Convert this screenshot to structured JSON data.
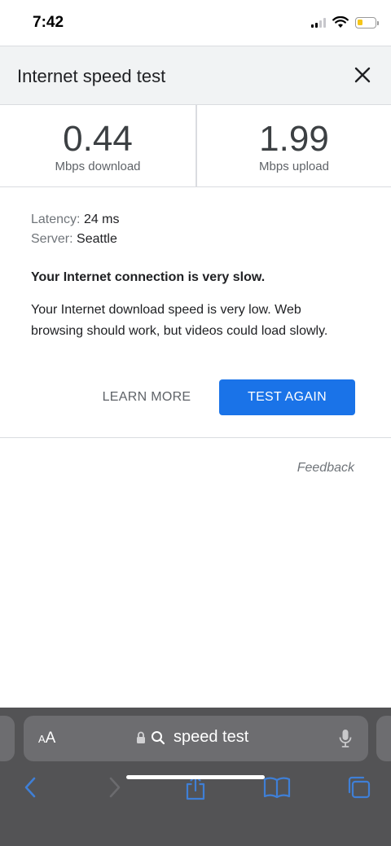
{
  "status_bar": {
    "time": "7:42",
    "battery_level": 0.3,
    "battery_color": "#f5c518"
  },
  "header": {
    "title": "Internet speed test",
    "close_icon": "close-icon"
  },
  "metrics": {
    "download": {
      "value": "0.44",
      "unit": "Mbps download"
    },
    "upload": {
      "value": "1.99",
      "unit": "Mbps upload"
    }
  },
  "details": {
    "latency_label": "Latency:",
    "latency_value": "24 ms",
    "server_label": "Server:",
    "server_value": "Seattle",
    "verdict": "Your Internet connection is very slow.",
    "description": "Your Internet download speed is very low. Web browsing should work, but videos could load slowly."
  },
  "actions": {
    "learn_more": "LEARN MORE",
    "test_again": "TEST AGAIN",
    "accent_color": "#1a73e8"
  },
  "feedback": "Feedback",
  "safari": {
    "aa_small": "A",
    "aa_big": "A",
    "address": "speed test",
    "icons": [
      "lock-icon",
      "search-icon",
      "microphone-icon",
      "back-icon",
      "forward-icon",
      "share-icon",
      "bookmarks-icon",
      "tabs-icon"
    ],
    "toolbar_color": "#3f7fd6"
  }
}
